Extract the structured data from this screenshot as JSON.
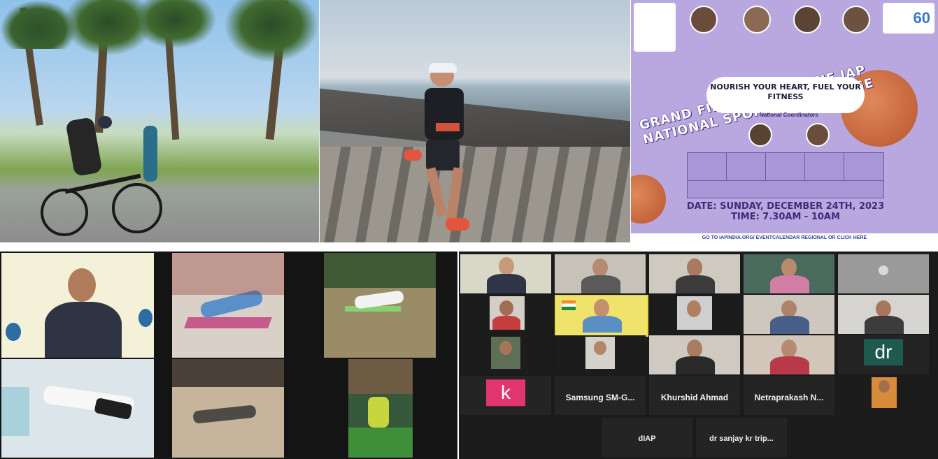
{
  "poster": {
    "title": "GRAND FINALE OF ONLINE IAP NATIONAL SPORTS CHALLENGE",
    "tagline": "NOURISH YOUR HEART, FUEL YOUR FITNESS",
    "coordinators": "National Coordinators",
    "date": "DATE: SUNDAY, DECEMBER 24TH, 2023",
    "time": "TIME: 7.30AM - 10AM",
    "link": "GO TO IAPINDIA.ORG/ EVENTCALENDAR REGIONAL OR CLICK HERE",
    "badge": "60"
  },
  "zoom_right": {
    "big_tiles": [
      {
        "initial": "dr",
        "bg": "#1f5a4e"
      },
      {
        "initial": "k",
        "bg": "#e0356f"
      }
    ],
    "text_tiles": [
      {
        "title": "Samsung SM-G..."
      },
      {
        "title": "Khurshid Ahmad"
      },
      {
        "title": "Netraprakash N..."
      },
      {
        "title": "dIAP"
      },
      {
        "title": "dr sanjay kr trip..."
      }
    ]
  }
}
